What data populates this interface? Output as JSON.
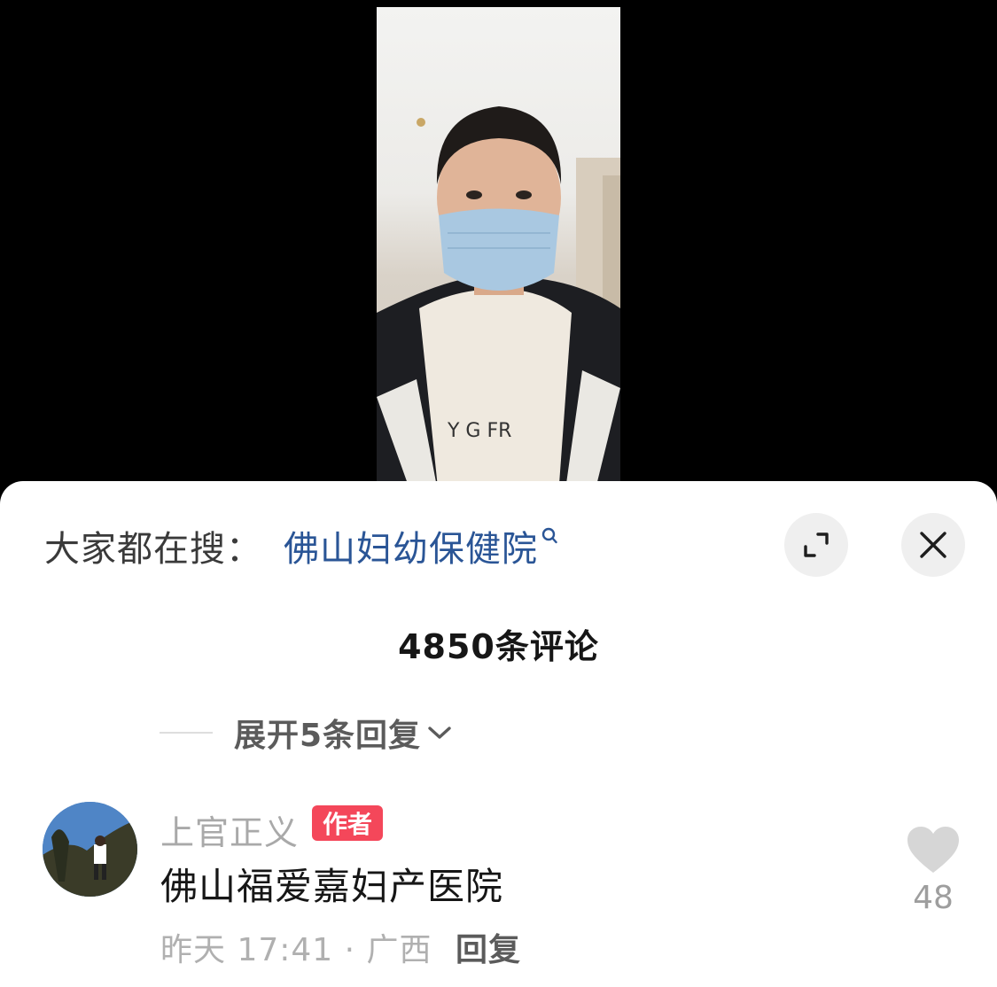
{
  "search_hint": {
    "prefix": "大家都在搜：",
    "keyword": "佛山妇幼保健院"
  },
  "header": {
    "comment_count_label": "4850条评论"
  },
  "controls": {
    "expand_icon": "expand-arrows-icon",
    "close_icon": "close-icon"
  },
  "thread": {
    "expand_replies_label": "展开5条回复",
    "expand_icon": "chevron-down-icon"
  },
  "comment": {
    "author": "上官正义",
    "badge": "作者",
    "text": "佛山福爱嘉妇产医院",
    "meta": "昨天 17:41 · 广西",
    "reply_label": "回复",
    "likes": "48"
  },
  "colors": {
    "keyword_blue": "#2a5596",
    "badge_red": "#f4475a",
    "sheet_bg": "#ffffff"
  }
}
